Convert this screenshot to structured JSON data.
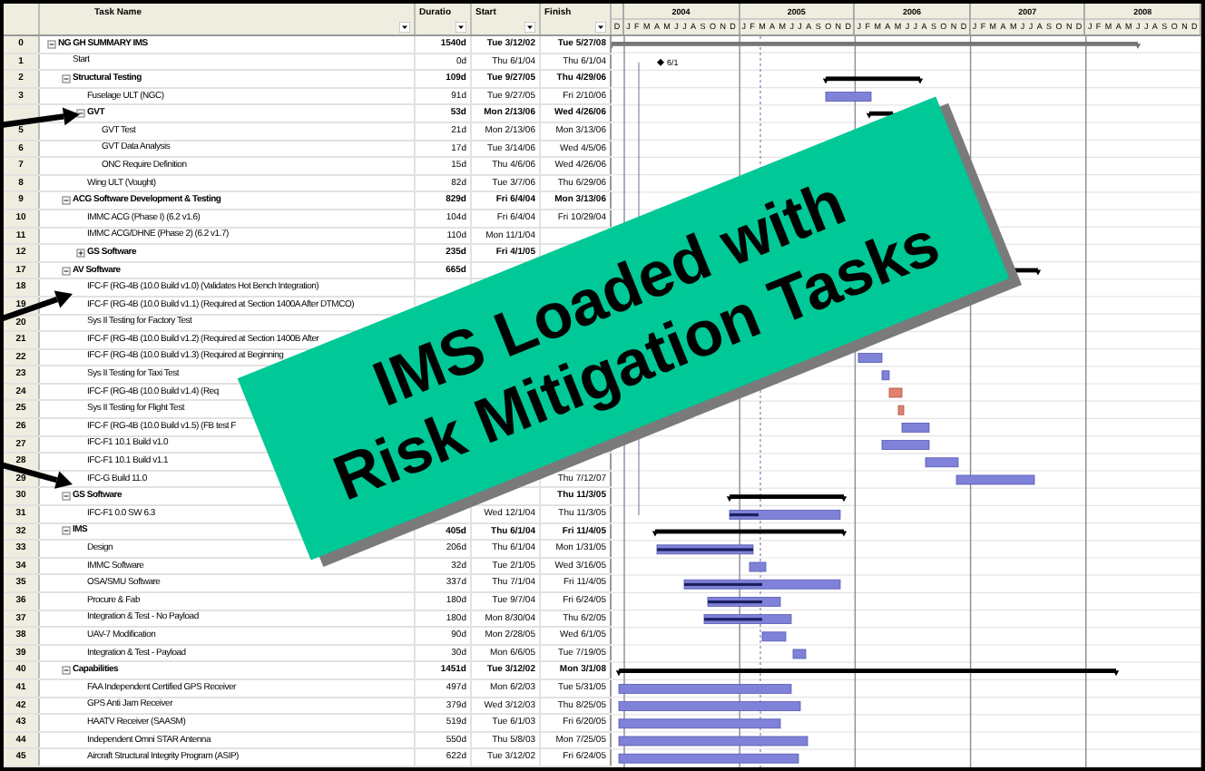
{
  "columns": [
    "Task Name",
    "Duratio",
    "Start",
    "Finish"
  ],
  "timescale": [
    {
      "months": [
        "D"
      ]
    },
    {
      "year": "2004",
      "months": [
        "J",
        "F",
        "M",
        "A",
        "M",
        "J",
        "J",
        "A",
        "S",
        "O",
        "N",
        "D"
      ]
    },
    {
      "year": "2005",
      "months": [
        "J",
        "F",
        "M",
        "A",
        "M",
        "J",
        "J",
        "A",
        "S",
        "O",
        "N",
        "D"
      ]
    },
    {
      "year": "2006",
      "months": [
        "J",
        "F",
        "M",
        "A",
        "M",
        "J",
        "J",
        "A",
        "S",
        "O",
        "N",
        "D"
      ]
    },
    {
      "year": "2007",
      "months": [
        "J",
        "F",
        "M",
        "A",
        "M",
        "J",
        "J",
        "A",
        "S",
        "O",
        "N",
        "D"
      ]
    },
    {
      "year": "2008",
      "months": [
        "J",
        "F",
        "M",
        "A",
        "M",
        "J",
        "J",
        "A",
        "S",
        "O",
        "N",
        "D"
      ]
    }
  ],
  "gantt": {
    "milestone_label": "6/1"
  },
  "tasks": [
    {
      "id": "0",
      "kind": "summary",
      "expanded": true,
      "name": "NG GH SUMMARY IMS",
      "duration": "1540d",
      "start": "Tue 3/12/02",
      "finish": "Tue 5/27/08",
      "children": [
        {
          "id": "1",
          "kind": "task",
          "name": "Start",
          "duration": "0d",
          "start": "Thu 6/1/04",
          "finish": "Thu 6/1/04"
        },
        {
          "id": "2",
          "kind": "summary",
          "expanded": true,
          "name": "Structural Testing",
          "duration": "109d",
          "start": "Tue 9/27/05",
          "finish": "Thu 4/29/06",
          "children": [
            {
              "id": "3",
              "kind": "task",
              "name": "Fuselage ULT (NGC)",
              "duration": "91d",
              "start": "Tue 9/27/05",
              "finish": "Fri 2/10/06"
            },
            {
              "kind": "summary",
              "expanded": true,
              "name": "GVT",
              "duration": "53d",
              "start": "Mon 2/13/06",
              "finish": "Wed 4/26/06",
              "children": [
                {
                  "id": "5",
                  "kind": "task",
                  "name": "GVT Test",
                  "duration": "21d",
                  "start": "Mon 2/13/06",
                  "finish": "Mon 3/13/06"
                },
                {
                  "id": "6",
                  "kind": "task",
                  "name": "GVT Data Analysis",
                  "duration": "17d",
                  "start": "Tue 3/14/06",
                  "finish": "Wed 4/5/06"
                },
                {
                  "id": "7",
                  "kind": "task",
                  "name": "ONC Require Definition",
                  "duration": "15d",
                  "start": "Thu 4/6/06",
                  "finish": "Wed 4/26/06"
                }
              ]
            },
            {
              "id": "8",
              "kind": "task",
              "name": "Wing ULT (Vought)",
              "duration": "82d",
              "start": "Tue 3/7/06",
              "finish": "Thu 6/29/06"
            }
          ]
        },
        {
          "id": "9",
          "kind": "summary",
          "expanded": true,
          "name": "ACG Software Development & Testing",
          "duration": "829d",
          "start": "Fri 6/4/04",
          "finish": "Mon 3/13/06",
          "children": [
            {
              "id": "10",
              "kind": "task",
              "name": "IMMC ACG (Phase I) (6.2 v1.6)",
              "duration": "104d",
              "start": "Fri 6/4/04",
              "finish": "Fri 10/29/04"
            },
            {
              "id": "11",
              "kind": "task",
              "name": "IMMC ACG/DHNE (Phase 2) (6.2 v1.7)",
              "duration": "110d",
              "start": "Mon 11/1/04"
            },
            {
              "id": "12",
              "kind": "summary",
              "expanded": false,
              "name": "GS Software",
              "duration": "235d",
              "start": "Fri 4/1/05"
            }
          ]
        },
        {
          "id": "17",
          "kind": "summary",
          "expanded": true,
          "name": "AV Software",
          "duration": "665d",
          "children": [
            {
              "id": "18",
              "kind": "task",
              "name": "IFC-F (RG-4B (10.0 Build v1.0) (Validates Hot Bench Integration)"
            },
            {
              "id": "19",
              "kind": "task",
              "name": "IFC-F (RG-4B (10.0 Build v1.1) (Required at Section 1400A After DTMCO)"
            },
            {
              "id": "20",
              "kind": "task",
              "name": "Sys II Testing for Factory Test"
            },
            {
              "id": "21",
              "kind": "task",
              "name": "IFC-F (RG-4B (10.0 Build v1.2) (Required at Section 1400B After"
            },
            {
              "id": "22",
              "kind": "task",
              "name": "IFC-F (RG-4B (10.0 Build v1.3) (Required at Beginning"
            },
            {
              "id": "23",
              "kind": "task",
              "name": "Sys II Testing for Taxi Test"
            },
            {
              "id": "24",
              "kind": "task",
              "name": "IFC-F (RG-4B (10.0 Build v1.4) (Req"
            },
            {
              "id": "25",
              "kind": "task",
              "name": "Sys II Testing for Flight Test"
            },
            {
              "id": "26",
              "kind": "task",
              "name": "IFC-F (RG-4B (10.0 Build v1.5) (FB test F"
            },
            {
              "id": "27",
              "kind": "task",
              "name": "IFC-F1 10.1 Build v1.0"
            },
            {
              "id": "28",
              "kind": "task",
              "name": "IFC-F1 10.1 Build v1.1"
            },
            {
              "id": "29",
              "kind": "task",
              "name": "IFC-G Build 11.0",
              "finish": "Thu 7/12/07"
            }
          ]
        },
        {
          "id": "30",
          "kind": "summary",
          "expanded": true,
          "name": "GS Software",
          "finish": "Thu 11/3/05",
          "children": [
            {
              "id": "31",
              "kind": "task",
              "name": "IFC-F1 0.0 SW 6.3",
              "start": "Wed 12/1/04",
              "finish": "Thu 11/3/05"
            }
          ]
        },
        {
          "id": "32",
          "kind": "summary",
          "expanded": true,
          "name": "IMS",
          "duration": "405d",
          "start": "Thu 6/1/04",
          "finish": "Fri 11/4/05",
          "children": [
            {
              "id": "33",
              "kind": "task",
              "name": "Design",
              "duration": "206d",
              "start": "Thu 6/1/04",
              "finish": "Mon 1/31/05"
            },
            {
              "id": "34",
              "kind": "task",
              "name": "IMMC Software",
              "duration": "32d",
              "start": "Tue 2/1/05",
              "finish": "Wed 3/16/05"
            },
            {
              "id": "35",
              "kind": "task",
              "name": "OSA/SMU Software",
              "duration": "337d",
              "start": "Thu 7/1/04",
              "finish": "Fri 11/4/05"
            },
            {
              "id": "36",
              "kind": "task",
              "name": "Procure & Fab",
              "duration": "180d",
              "start": "Tue 9/7/04",
              "finish": "Fri 6/24/05"
            },
            {
              "id": "37",
              "kind": "task",
              "name": "Integration & Test - No Payload",
              "duration": "180d",
              "start": "Mon 8/30/04",
              "finish": "Thu 6/2/05"
            },
            {
              "id": "38",
              "kind": "task",
              "name": "UAV-7 Modification",
              "duration": "90d",
              "start": "Mon 2/28/05",
              "finish": "Wed 6/1/05"
            },
            {
              "id": "39",
              "kind": "task",
              "name": "Integration & Test - Payload",
              "duration": "30d",
              "start": "Mon 6/6/05",
              "finish": "Tue 7/19/05"
            }
          ]
        },
        {
          "id": "40",
          "kind": "summary",
          "expanded": true,
          "name": "Capabilities",
          "duration": "1451d",
          "start": "Tue 3/12/02",
          "finish": "Mon 3/1/08",
          "children": [
            {
              "id": "41",
              "kind": "task",
              "name": "FAA Independent Certified GPS Receiver",
              "duration": "497d",
              "start": "Mon 6/2/03",
              "finish": "Tue 5/31/05"
            },
            {
              "id": "42",
              "kind": "task",
              "name": "GPS Anti Jam Receiver",
              "duration": "379d",
              "start": "Wed 3/12/03",
              "finish": "Thu 8/25/05"
            },
            {
              "id": "43",
              "kind": "task",
              "name": "HAATV Receiver (SAASM)",
              "duration": "519d",
              "start": "Tue 6/1/03",
              "finish": "Fri 6/20/05"
            },
            {
              "id": "44",
              "kind": "task",
              "name": "Independent Omni STAR Antenna",
              "duration": "550d",
              "start": "Thu 5/8/03",
              "finish": "Mon 7/25/05"
            },
            {
              "id": "45",
              "kind": "task",
              "name": "Aircraft Structural Integrity Program (ASIP)",
              "duration": "622d",
              "start": "Tue 3/12/02",
              "finish": "Fri 6/24/05"
            }
          ]
        }
      ]
    }
  ],
  "callout": {
    "lines": [
      "IMS Loaded with",
      "Risk Mitigation Tasks"
    ]
  }
}
